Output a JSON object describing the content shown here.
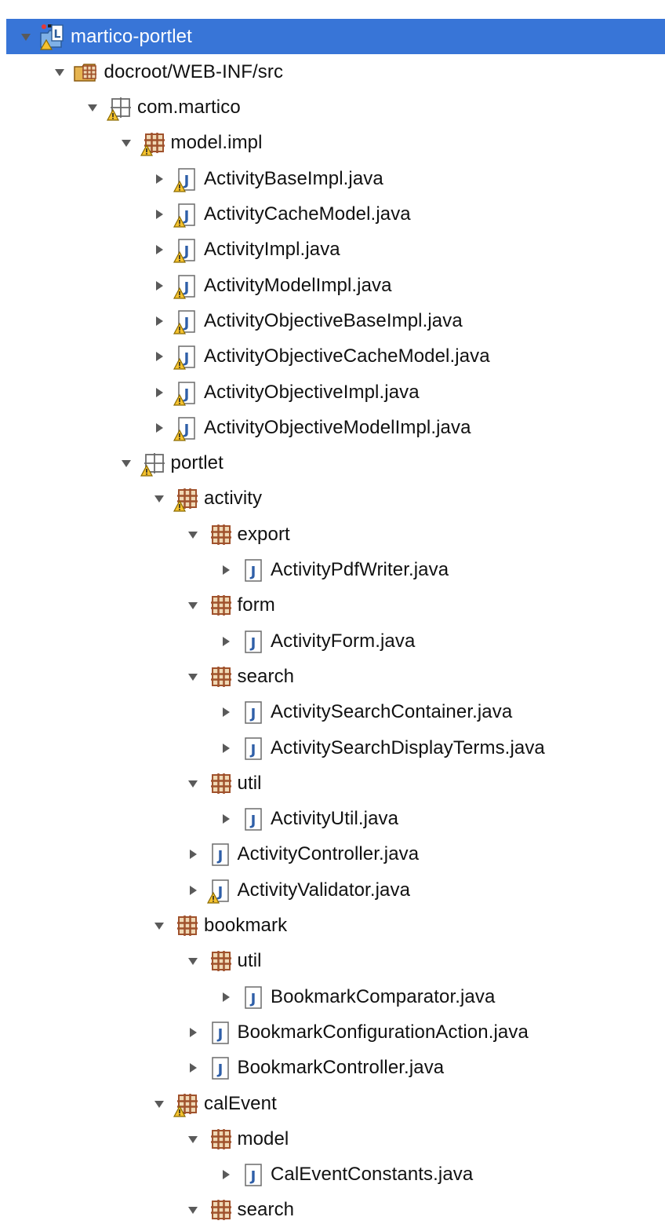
{
  "colors": {
    "selection": "#3875d7",
    "package": "#a0522d",
    "java_file": "#2f5fa8",
    "warning": "#f5c22e"
  },
  "tree": {
    "nodes": [
      {
        "label": "martico-portlet",
        "depth": 0,
        "expanded": true,
        "icon": "project-icon",
        "selected": true
      },
      {
        "label": "docroot/WEB-INF/src",
        "depth": 1,
        "expanded": true,
        "icon": "source-folder-icon"
      },
      {
        "label": "com.martico",
        "depth": 2,
        "expanded": true,
        "icon": "empty-package-icon",
        "warning": true
      },
      {
        "label": "model.impl",
        "depth": 3,
        "expanded": true,
        "icon": "package-icon",
        "warning": true
      },
      {
        "label": "ActivityBaseImpl.java",
        "depth": 4,
        "expanded": false,
        "icon": "java-file-icon",
        "warning": true
      },
      {
        "label": "ActivityCacheModel.java",
        "depth": 4,
        "expanded": false,
        "icon": "java-file-icon",
        "warning": true
      },
      {
        "label": "ActivityImpl.java",
        "depth": 4,
        "expanded": false,
        "icon": "java-file-icon",
        "warning": true
      },
      {
        "label": "ActivityModelImpl.java",
        "depth": 4,
        "expanded": false,
        "icon": "java-file-icon",
        "warning": true
      },
      {
        "label": "ActivityObjectiveBaseImpl.java",
        "depth": 4,
        "expanded": false,
        "icon": "java-file-icon",
        "warning": true
      },
      {
        "label": "ActivityObjectiveCacheModel.java",
        "depth": 4,
        "expanded": false,
        "icon": "java-file-icon",
        "warning": true
      },
      {
        "label": "ActivityObjectiveImpl.java",
        "depth": 4,
        "expanded": false,
        "icon": "java-file-icon",
        "warning": true
      },
      {
        "label": "ActivityObjectiveModelImpl.java",
        "depth": 4,
        "expanded": false,
        "icon": "java-file-icon",
        "warning": true
      },
      {
        "label": "portlet",
        "depth": 3,
        "expanded": true,
        "icon": "empty-package-icon",
        "warning": true
      },
      {
        "label": "activity",
        "depth": 4,
        "expanded": true,
        "icon": "package-icon",
        "warning": true
      },
      {
        "label": "export",
        "depth": 5,
        "expanded": true,
        "icon": "package-icon"
      },
      {
        "label": "ActivityPdfWriter.java",
        "depth": 6,
        "expanded": false,
        "icon": "java-file-icon"
      },
      {
        "label": "form",
        "depth": 5,
        "expanded": true,
        "icon": "package-icon"
      },
      {
        "label": "ActivityForm.java",
        "depth": 6,
        "expanded": false,
        "icon": "java-file-icon"
      },
      {
        "label": "search",
        "depth": 5,
        "expanded": true,
        "icon": "package-icon"
      },
      {
        "label": "ActivitySearchContainer.java",
        "depth": 6,
        "expanded": false,
        "icon": "java-file-icon"
      },
      {
        "label": "ActivitySearchDisplayTerms.java",
        "depth": 6,
        "expanded": false,
        "icon": "java-file-icon"
      },
      {
        "label": "util",
        "depth": 5,
        "expanded": true,
        "icon": "package-icon"
      },
      {
        "label": "ActivityUtil.java",
        "depth": 6,
        "expanded": false,
        "icon": "java-file-icon"
      },
      {
        "label": "ActivityController.java",
        "depth": 5,
        "expanded": false,
        "icon": "java-file-icon"
      },
      {
        "label": "ActivityValidator.java",
        "depth": 5,
        "expanded": false,
        "icon": "java-file-icon",
        "warning": true
      },
      {
        "label": "bookmark",
        "depth": 4,
        "expanded": true,
        "icon": "package-icon"
      },
      {
        "label": "util",
        "depth": 5,
        "expanded": true,
        "icon": "package-icon"
      },
      {
        "label": "BookmarkComparator.java",
        "depth": 6,
        "expanded": false,
        "icon": "java-file-icon"
      },
      {
        "label": "BookmarkConfigurationAction.java",
        "depth": 5,
        "expanded": false,
        "icon": "java-file-icon"
      },
      {
        "label": "BookmarkController.java",
        "depth": 5,
        "expanded": false,
        "icon": "java-file-icon"
      },
      {
        "label": "calEvent",
        "depth": 4,
        "expanded": true,
        "icon": "package-icon",
        "warning": true
      },
      {
        "label": "model",
        "depth": 5,
        "expanded": true,
        "icon": "package-icon"
      },
      {
        "label": "CalEventConstants.java",
        "depth": 6,
        "expanded": false,
        "icon": "java-file-icon"
      },
      {
        "label": "search",
        "depth": 5,
        "expanded": true,
        "icon": "package-icon"
      }
    ]
  }
}
